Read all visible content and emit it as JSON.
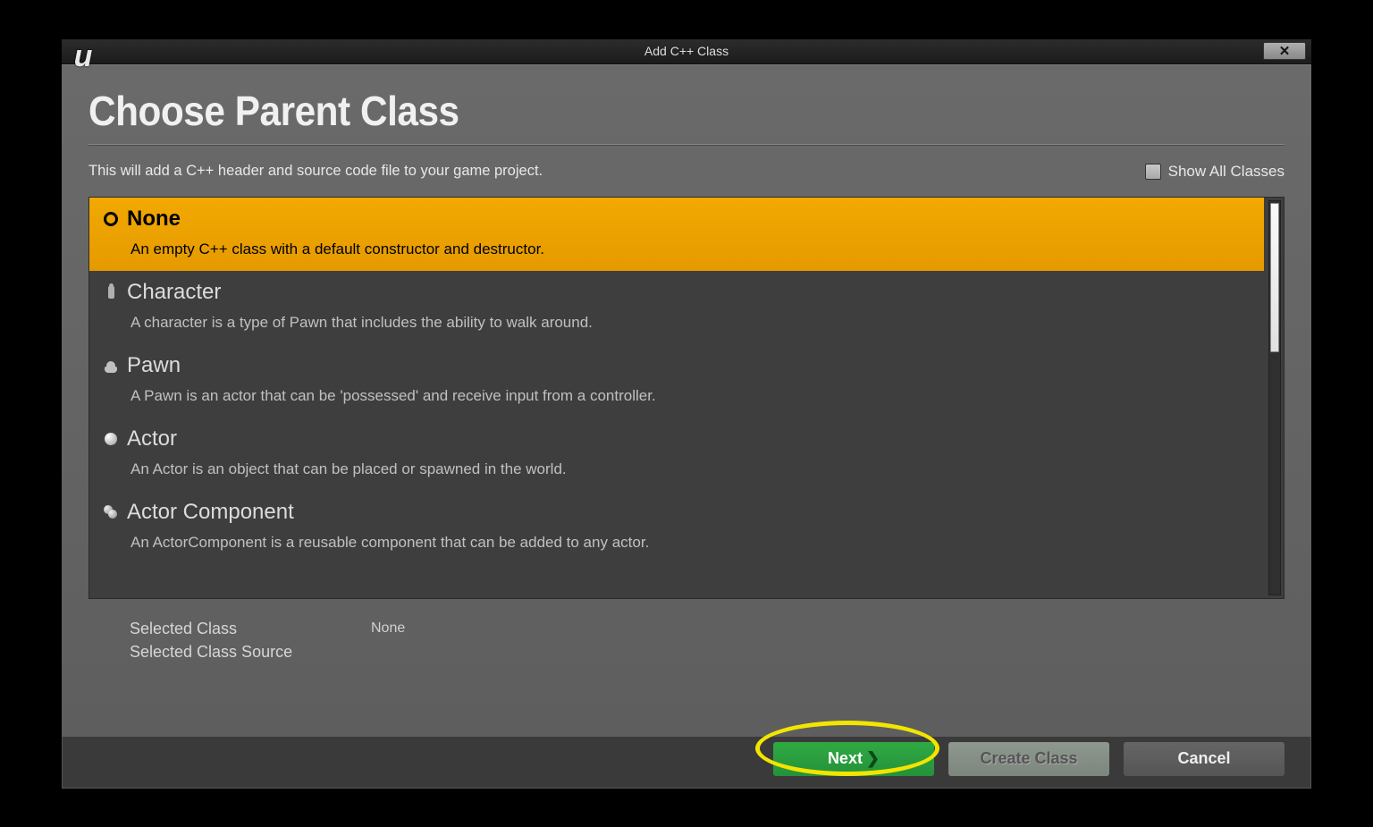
{
  "window": {
    "title": "Add C++ Class"
  },
  "page": {
    "heading": "Choose Parent Class",
    "subtitle": "This will add a C++ header and source code file to your game project.",
    "show_all_label": "Show All Classes"
  },
  "classes": [
    {
      "name": "None",
      "desc": "An empty C++ class with a default constructor and destructor.",
      "icon": "radio",
      "selected": true
    },
    {
      "name": "Character",
      "desc": "A character is a type of Pawn that includes the ability to walk around.",
      "icon": "character",
      "selected": false
    },
    {
      "name": "Pawn",
      "desc": "A Pawn is an actor that can be 'possessed' and receive input from a controller.",
      "icon": "pawn",
      "selected": false
    },
    {
      "name": "Actor",
      "desc": "An Actor is an object that can be placed or spawned in the world.",
      "icon": "actor",
      "selected": false
    },
    {
      "name": "Actor Component",
      "desc": "An ActorComponent is a reusable component that can be added to any actor.",
      "icon": "component",
      "selected": false
    }
  ],
  "selected": {
    "class_label": "Selected Class",
    "class_value": "None",
    "source_label": "Selected Class Source",
    "source_value": ""
  },
  "buttons": {
    "next": "Next",
    "create": "Create Class",
    "cancel": "Cancel"
  }
}
